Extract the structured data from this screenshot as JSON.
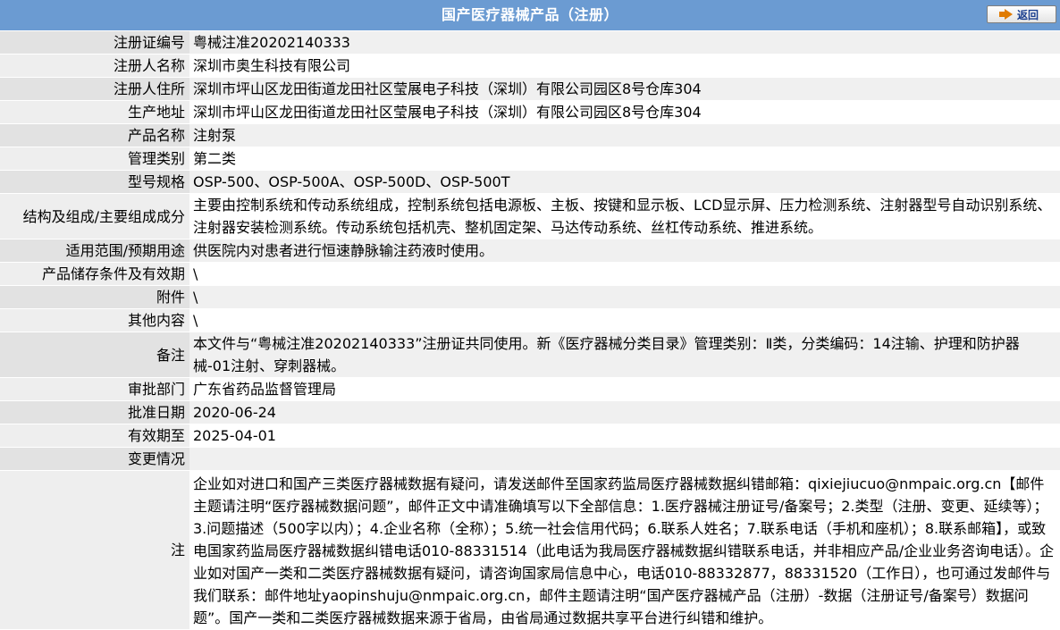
{
  "header": {
    "title": "国产医疗器械产品（注册）",
    "back_label": "返回"
  },
  "rows": [
    {
      "label": "注册证编号",
      "value": "粤械注准20202140333"
    },
    {
      "label": "注册人名称",
      "value": "深圳市奥生科技有限公司"
    },
    {
      "label": "注册人住所",
      "value": "深圳市坪山区龙田街道龙田社区莹展电子科技（深圳）有限公司园区8号仓库304"
    },
    {
      "label": "生产地址",
      "value": "深圳市坪山区龙田街道龙田社区莹展电子科技（深圳）有限公司园区8号仓库304"
    },
    {
      "label": "产品名称",
      "value": "注射泵"
    },
    {
      "label": "管理类别",
      "value": "第二类"
    },
    {
      "label": "型号规格",
      "value": "OSP-500、OSP-500A、OSP-500D、OSP-500T"
    },
    {
      "label": "结构及组成/主要组成成分",
      "value": "主要由控制系统和传动系统组成，控制系统包括电源板、主板、按键和显示板、LCD显示屏、压力检测系统、注射器型号自动识别系统、注射器安装检测系统。传动系统包括机壳、整机固定架、马达传动系统、丝杠传动系统、推进系统。"
    },
    {
      "label": "适用范围/预期用途",
      "value": "供医院内对患者进行恒速静脉输注药液时使用。"
    },
    {
      "label": "产品储存条件及有效期",
      "value": "\\"
    },
    {
      "label": "附件",
      "value": "\\"
    },
    {
      "label": "其他内容",
      "value": "\\"
    },
    {
      "label": "备注",
      "value": "本文件与“粤械注准20202140333”注册证共同使用。新《医疗器械分类目录》管理类别：Ⅱ类，分类编码：14注输、护理和防护器械-01注射、穿刺器械。"
    },
    {
      "label": "审批部门",
      "value": "广东省药品监督管理局"
    },
    {
      "label": "批准日期",
      "value": "2020-06-24"
    },
    {
      "label": "有效期至",
      "value": "2025-04-01"
    },
    {
      "label": "变更情况",
      "value": ""
    }
  ],
  "note": {
    "label": "注",
    "text": "企业如对进口和国产三类医疗器械数据有疑问，请发送邮件至国家药监局医疗器械数据纠错邮箱：qixiejiucuo@nmpaic.org.cn【邮件主题请注明“医疗器械数据问题”，邮件正文中请准确填写以下全部信息：1.医疗器械注册证号/备案号；2.类型（注册、变更、延续等）；3.问题描述（500字以内）；4.企业名称（全称）；5.统一社会信用代码；6.联系人姓名；7.联系电话（手机和座机）；8.联系邮箱】，或致电国家药监局医疗器械数据纠错电话010-88331514（此电话为我局医疗器械数据纠错联系电话，并非相应产品/企业业务咨询电话）。企业如对国产一类和二类医疗器械数据有疑问，请咨询国家局信息中心，电话010-88332877，88331520（工作日），也可通过发邮件与我们联系：邮件地址yaopinshuju@nmpaic.org.cn，邮件主题请注明“国产医疗器械产品（注册）-数据（注册证号/备案号）数据问题”。国产一类和二类医疗器械数据来源于省局，由省局通过数据共享平台进行纠错和维护。"
  }
}
